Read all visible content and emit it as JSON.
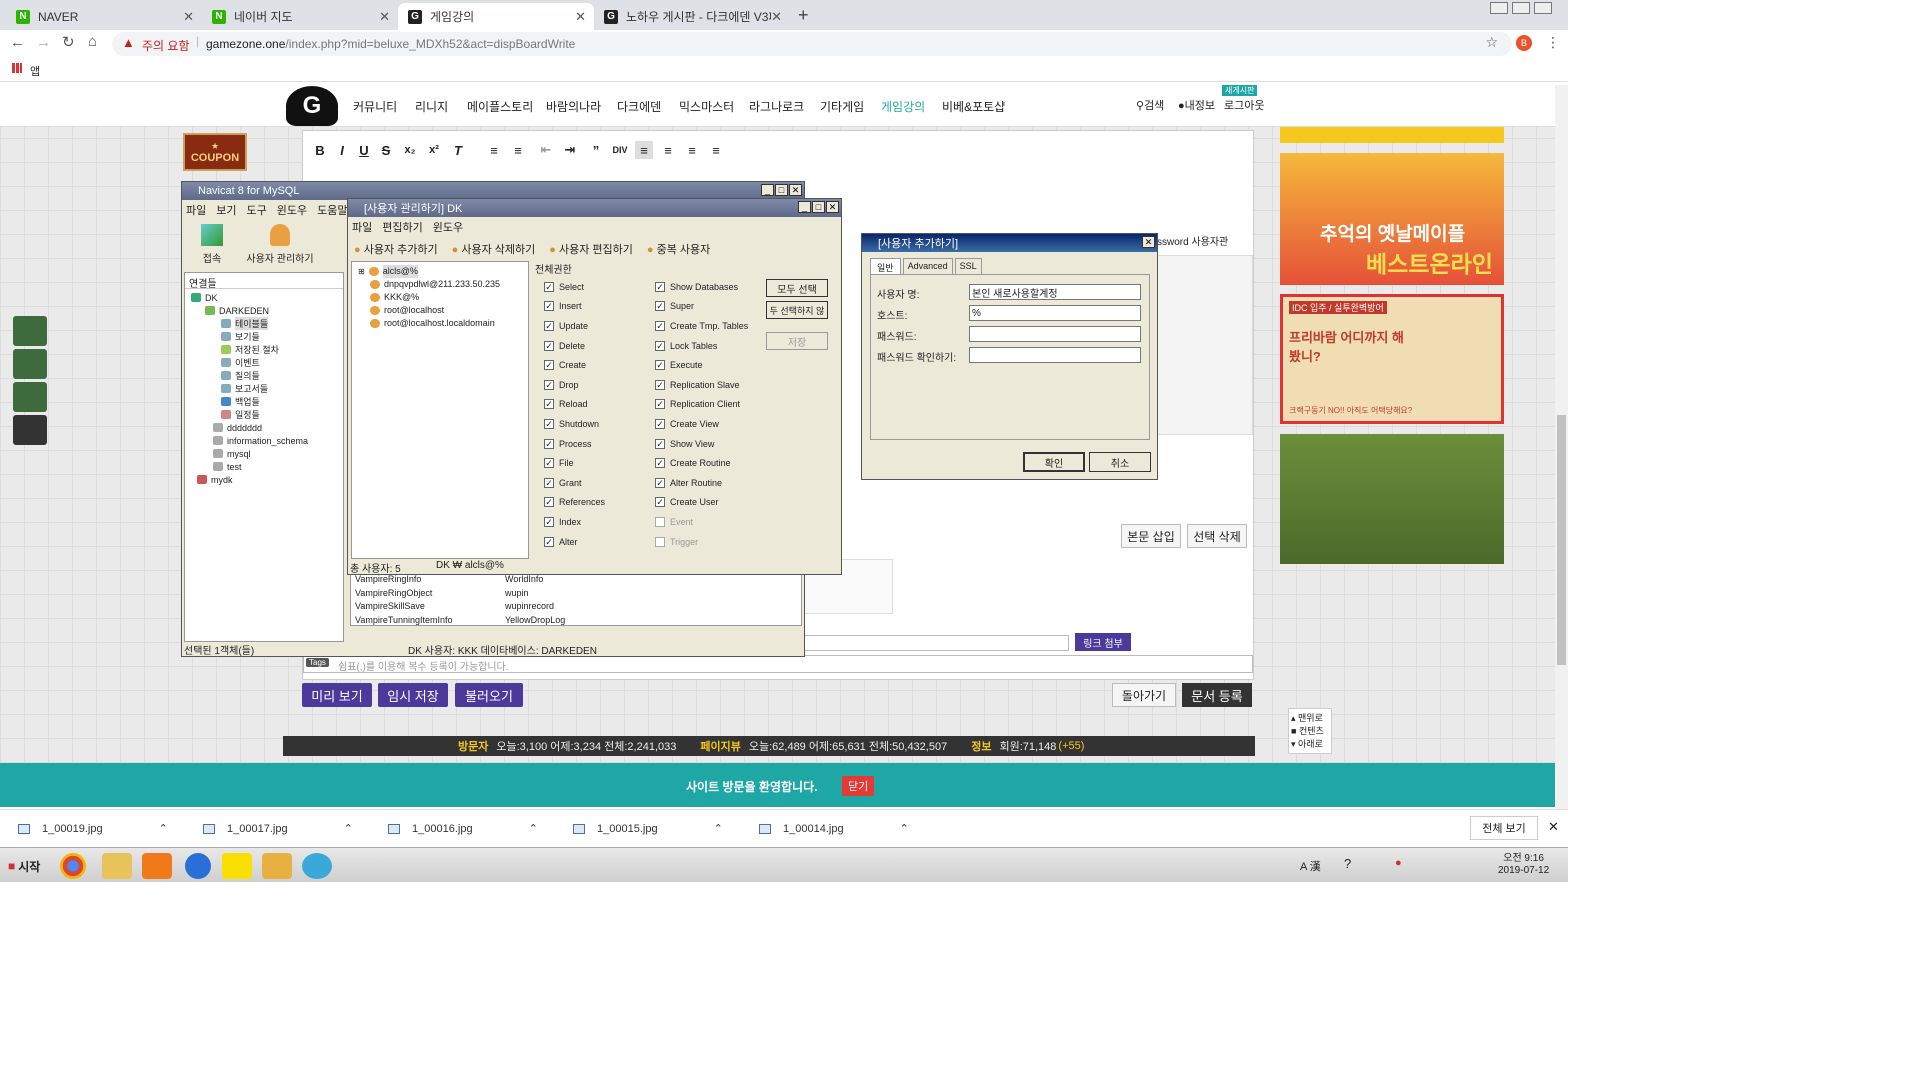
{
  "browser": {
    "tabs": [
      {
        "label": "NAVER",
        "fav": "N",
        "color": "#2db400"
      },
      {
        "label": "네이버 지도",
        "fav": "N",
        "color": "#2db400"
      },
      {
        "label": "게임강의",
        "fav": "G",
        "color": "#222"
      },
      {
        "label": "노하우 게시판 - 다크에덴 V3패",
        "fav": "G",
        "color": "#222"
      }
    ],
    "security_label": "주의 요함",
    "url_host": "gamezone.one",
    "url_path": "/index.php?mid=beluxe_MDXh52&act=dispBoardWrite",
    "bookmarks_label": "앱",
    "profile_initial": "B"
  },
  "site": {
    "menu": [
      "커뮤니티",
      "리니지",
      "메이플스토리",
      "바람의나라",
      "다크에덴",
      "믹스마스터",
      "라그나로크",
      "기타게임",
      "게임강의",
      "비베&포토샵"
    ],
    "active_menu": "게임강의",
    "right_links": [
      "검색",
      "내정보",
      "로그아웃"
    ],
    "new_badge": "새게시판",
    "coupon": "COUPON",
    "buttons": {
      "preview": "미리 보기",
      "temp_save": "임시 저장",
      "load": "불러오기",
      "back": "돌아가기",
      "submit": "문서 등록",
      "insert_body": "본문 삽입",
      "delete_selected": "선택 삭제",
      "link_attach": "링크 첨부"
    },
    "tags_label": "Tags",
    "tags_placeholder": "쉼표(,)를 이용해 복수 등록이 가능합니다.",
    "pw_fragment": "ssword 사용자관",
    "stats": {
      "visitors_label": "방문자",
      "visitors": "오늘:3,100 어제:3,234 전체:2,241,033",
      "pageviews_label": "페이지뷰",
      "pageviews": "오늘:62,489 어제:65,631 전체:50,432,507",
      "info_label": "정보",
      "members": "회원:71,148",
      "members_new": "(+55)"
    },
    "welcome": "사이트 방문을 환영합니다.",
    "close": "닫기",
    "scroll_nav": [
      "맨위로",
      "컨텐츠",
      "아래로"
    ],
    "ads": {
      "ad1_line1": "추억의 옛날메이플",
      "ad1_line2": "베스트온라인",
      "ad2_top": "IDC 입주 / 실투완벽방어",
      "ad2_title": "프리바람 어디까지 해봤니?",
      "ad2_bottom": "크랙구동기 NO!! 아직도 어택당해요?"
    }
  },
  "navicat": {
    "title": "Navicat 8 for MySQL",
    "menu": [
      "파일",
      "보기",
      "도구",
      "윈도우",
      "도움말"
    ],
    "toolbar": [
      "접속",
      "사용자 관리하기"
    ],
    "tree_header": "연결들",
    "tree": [
      {
        "label": "DK",
        "level": 0
      },
      {
        "label": "DARKEDEN",
        "level": 1
      },
      {
        "label": "테이블들",
        "level": 2
      },
      {
        "label": "보기들",
        "level": 2
      },
      {
        "label": "저장된 절차",
        "level": 2
      },
      {
        "label": "이벤트",
        "level": 2
      },
      {
        "label": "질의들",
        "level": 2
      },
      {
        "label": "보고서들",
        "level": 2
      },
      {
        "label": "백업들",
        "level": 2
      },
      {
        "label": "일정들",
        "level": 2
      },
      {
        "label": "ddddddd",
        "level": 1
      },
      {
        "label": "information_schema",
        "level": 1
      },
      {
        "label": "mysql",
        "level": 1
      },
      {
        "label": "test",
        "level": 1
      },
      {
        "label": "mydk",
        "level": 0
      }
    ],
    "tables_col1": [
      "VampireRingInfo",
      "VampireRingObject",
      "VampireSkillSave",
      "VampireTunningItemInfo"
    ],
    "tables_col2": [
      "WorldInfo",
      "wupin",
      "wupinrecord",
      "YellowDropLog"
    ],
    "status_left": "선택된 1객체(들)",
    "status_right": "DK    사용자: KKK    데이타베이스: DARKEDEN"
  },
  "usermgr": {
    "title": "[사용자 관리하기] DK",
    "menu": [
      "파일",
      "편집하기",
      "윈도우"
    ],
    "toolbar": [
      "사용자 추가하기",
      "사용자 삭제하기",
      "사용자 편집하기",
      "중복 사용자"
    ],
    "users": [
      "alcls@%",
      "dnpqvpdlwl@211.233.50.235",
      "KKK@%",
      "root@localhost",
      "root@localhost.localdomain"
    ],
    "privileges_title": "전체권한",
    "privs_col1": [
      "Select",
      "Insert",
      "Update",
      "Delete",
      "Create",
      "Drop",
      "Reload",
      "Shutdown",
      "Process",
      "File",
      "Grant",
      "References",
      "Index",
      "Alter"
    ],
    "privs_col2": [
      "Show Databases",
      "Super",
      "Create Tmp. Tables",
      "Lock Tables",
      "Execute",
      "Replication Slave",
      "Replication Client",
      "Create View",
      "Show View",
      "Create Routine",
      "Alter Routine",
      "Create User",
      "Event",
      "Trigger"
    ],
    "buttons": {
      "select_all": "모두 선택",
      "deselect_all": "두 선택하지 않",
      "save": "저장"
    },
    "status_left": "총 사용자: 5",
    "status_right": "DK ₩ alcls@%"
  },
  "adduser": {
    "title": "[사용자 추가하기]",
    "tabs": [
      "일반",
      "Advanced",
      "SSL"
    ],
    "labels": [
      "사용자 명:",
      "호스트:",
      "패스워드:",
      "패스워드 확인하기:"
    ],
    "values": {
      "username": "본인 새로사용할계정",
      "host": "%",
      "password": "",
      "confirm": ""
    },
    "ok": "확인",
    "cancel": "취소"
  },
  "downloads": {
    "files": [
      "1_00019.jpg",
      "1_00017.jpg",
      "1_00016.jpg",
      "1_00015.jpg",
      "1_00014.jpg"
    ],
    "show_all": "전체 보기"
  },
  "taskbar": {
    "start": "시작",
    "ime": "A 漢",
    "time": "오전 9:16",
    "date": "2019-07-12"
  }
}
